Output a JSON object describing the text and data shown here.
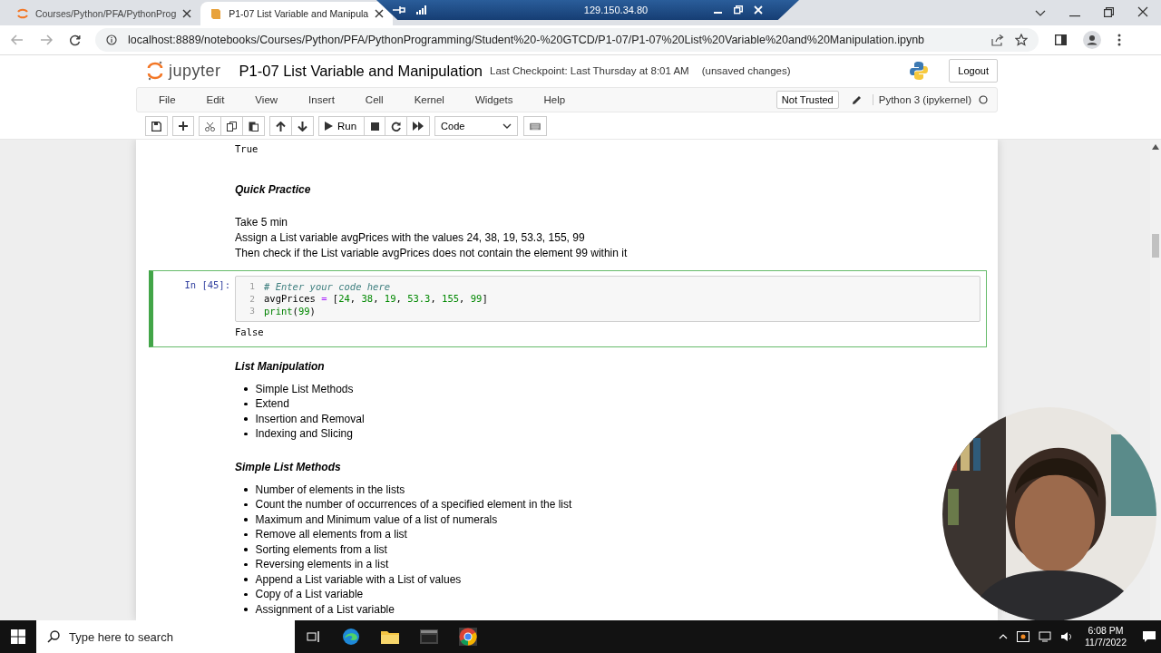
{
  "browser": {
    "tabs": [
      {
        "title": "Courses/Python/PFA/PythonProg",
        "selected": false
      },
      {
        "title": "P1-07 List Variable and Manipula",
        "selected": true
      }
    ],
    "remote_bar": {
      "address": "129.150.34.80"
    },
    "url": "localhost:8889/notebooks/Courses/Python/PFA/PythonProgramming/Student%20-%20GTCD/P1-07/P1-07%20List%20Variable%20and%20Manipulation.ipynb"
  },
  "header": {
    "logo": "jupyter",
    "title": "P1-07 List Variable and Manipulation",
    "checkpoint": "Last Checkpoint: Last Thursday at 8:01 AM",
    "save_status": "(unsaved changes)",
    "logout": "Logout"
  },
  "menu": [
    "File",
    "Edit",
    "View",
    "Insert",
    "Cell",
    "Kernel",
    "Widgets",
    "Help"
  ],
  "trust": "Not Trusted",
  "kernel": "Python 3 (ipykernel)",
  "toolbar": {
    "run": "Run",
    "cell_type": "Code"
  },
  "cells": [
    {
      "kind": "output",
      "text": "True"
    },
    {
      "kind": "heading",
      "text": "Quick Practice"
    },
    {
      "kind": "paragraph",
      "lines": [
        "Take 5 min",
        "Assign a List variable avgPrices with the values 24, 38, 19, 53.3, 155, 99",
        "Then check if the List variable avgPrices does not contain the element 99 within it"
      ]
    },
    {
      "kind": "code",
      "prompt": "In [45]:",
      "selected": true,
      "lines": [
        {
          "number": "1",
          "tokens": [
            {
              "kind": "comment",
              "text": "# Enter your code here"
            }
          ]
        },
        {
          "number": "2",
          "tokens": [
            {
              "kind": "name",
              "text": "avgPrices "
            },
            {
              "kind": "operator",
              "text": "="
            },
            {
              "kind": "name",
              "text": " ["
            },
            {
              "kind": "number",
              "text": "24"
            },
            {
              "kind": "name",
              "text": ", "
            },
            {
              "kind": "number",
              "text": "38"
            },
            {
              "kind": "name",
              "text": ", "
            },
            {
              "kind": "number",
              "text": "19"
            },
            {
              "kind": "name",
              "text": ", "
            },
            {
              "kind": "number",
              "text": "53.3"
            },
            {
              "kind": "name",
              "text": ", "
            },
            {
              "kind": "number",
              "text": "155"
            },
            {
              "kind": "name",
              "text": ", "
            },
            {
              "kind": "number",
              "text": "99"
            },
            {
              "kind": "name",
              "text": "]"
            }
          ]
        },
        {
          "number": "3",
          "tokens": [
            {
              "kind": "builtin",
              "text": "print"
            },
            {
              "kind": "name",
              "text": "("
            },
            {
              "kind": "number",
              "text": "99"
            },
            {
              "kind": "name",
              "text": ")"
            }
          ]
        }
      ],
      "output": "False"
    },
    {
      "kind": "heading",
      "text": "List Manipulation"
    },
    {
      "kind": "list",
      "items": [
        "Simple List Methods",
        "Extend",
        "Insertion and Removal",
        "Indexing and Slicing"
      ]
    },
    {
      "kind": "heading",
      "text": "Simple List Methods"
    },
    {
      "kind": "list",
      "items": [
        "Number of elements in the lists",
        "Count the number of occurrences of a specified element in the list",
        "Maximum and Minimum value of a list of numerals",
        "Remove all elements from a list",
        "Sorting elements from a list",
        "Reversing elements in a list",
        "Append a List variable with a List of values",
        "Copy of a List variable",
        "Assignment of a List variable"
      ]
    }
  ],
  "taskbar": {
    "search_placeholder": "Type here to search",
    "time": "6:08 PM",
    "date": "11/7/2022"
  }
}
